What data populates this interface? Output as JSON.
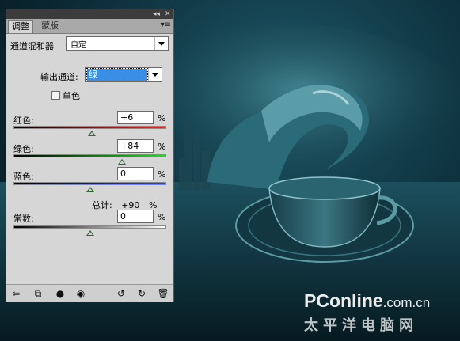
{
  "panel": {
    "topbar_controls": [
      "◂◂",
      "✕"
    ],
    "tabs": [
      {
        "label": "调整",
        "active": true
      },
      {
        "label": "蒙版",
        "active": false
      }
    ],
    "menu_icon": "panel-menu-icon",
    "preset": {
      "label": "通道混和器",
      "value": "自定"
    },
    "output_channel": {
      "label": "输出通道:",
      "value": "绿"
    },
    "monochrome": {
      "label": "单色",
      "checked": false
    },
    "channels": [
      {
        "label": "红色:",
        "value": "+6",
        "unit": "%",
        "percent": 6,
        "gradient": [
          "#000000",
          "#ff2020"
        ]
      },
      {
        "label": "绿色:",
        "value": "+84",
        "unit": "%",
        "percent": 84,
        "gradient": [
          "#000000",
          "#20e020"
        ]
      },
      {
        "label": "蓝色:",
        "value": "0",
        "unit": "%",
        "percent": 0,
        "gradient": [
          "#000000",
          "#2040ff"
        ]
      }
    ],
    "total": {
      "label": "总计:",
      "value": "+90",
      "unit": "%"
    },
    "constant": {
      "label": "常数:",
      "value": "0",
      "unit": "%",
      "percent": 0,
      "gradient": [
        "#000000",
        "#ffffff"
      ]
    },
    "bottom_icons": [
      "back-arrow-icon",
      "clip-layer-icon",
      "layer-visibility-toggle-icon",
      "eye-icon",
      "previous-state-icon",
      "reset-icon",
      "delete-icon"
    ]
  },
  "watermark": {
    "brand": "PConline",
    "domain": ".com.cn",
    "chinese": "太平洋电脑网"
  },
  "colors": {
    "panel_bg": "#d6d6d6",
    "selection": "#3a8ee6",
    "scene_dark": "#0a2630"
  }
}
